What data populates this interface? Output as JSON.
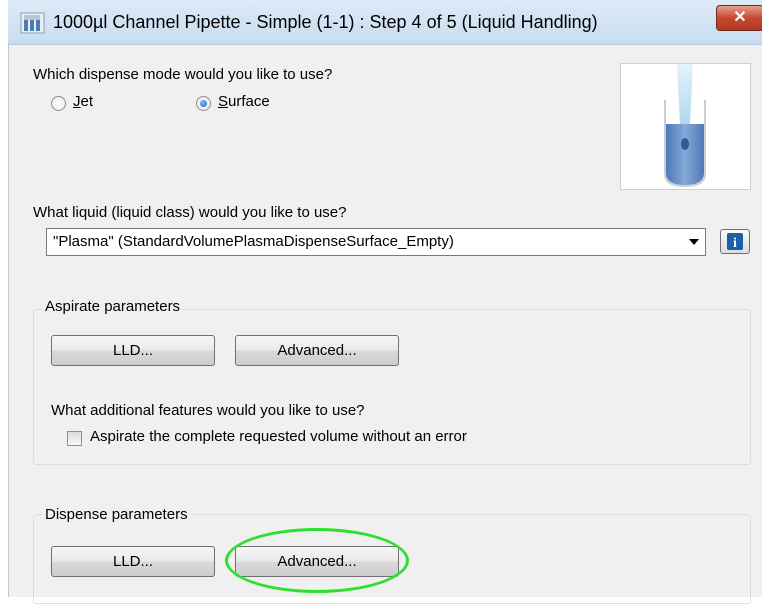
{
  "window": {
    "title": "1000µl Channel Pipette - Simple (1-1) : Step 4 of 5 (Liquid Handling)",
    "close_label": "✕"
  },
  "dispense_mode": {
    "question_pre": "Which dispense mode would you like to use?",
    "options": [
      {
        "label_u": "J",
        "label_rest": "et",
        "checked": false
      },
      {
        "label_u": "S",
        "label_rest": "urface",
        "checked": true
      }
    ]
  },
  "liquid_class": {
    "question": "What liquid (liquid class) would you like to use?",
    "value": "\"Plasma\"  (StandardVolumePlasmaDispenseSurface_Empty)",
    "info_label": "i"
  },
  "aspirate": {
    "group_label": "Aspirate parameters",
    "lld_label": "LLD...",
    "advanced_label": "Advanced...",
    "features_question": "What additional features would you like to use?",
    "checkbox_label": "Aspirate the complete requested volume without an error",
    "checkbox_checked": false
  },
  "dispense": {
    "group_label": "Dispense parameters",
    "lld_label": "LLD...",
    "advanced_label": "Advanced..."
  },
  "colors": {
    "highlight": "#2ee02e",
    "title_bar": "#d3e3f5",
    "close_button": "#c4482f"
  }
}
